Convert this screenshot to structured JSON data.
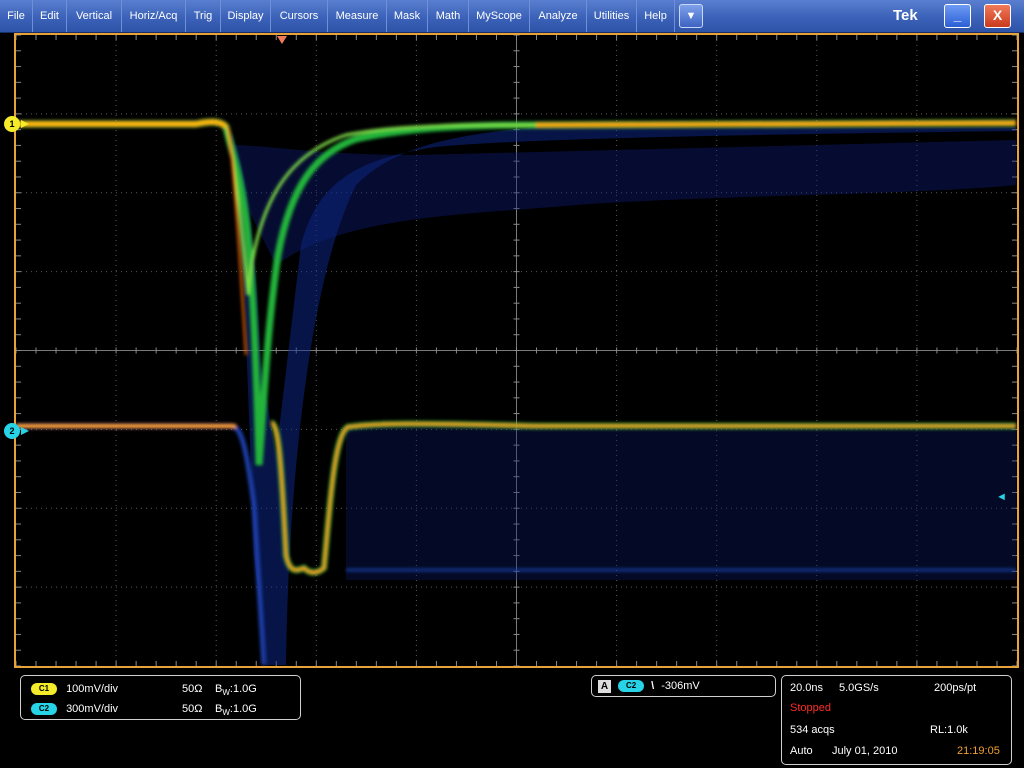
{
  "menu": {
    "items": [
      "File",
      "Edit",
      "Vertical",
      "Horiz/Acq",
      "Trig",
      "Display",
      "Cursors",
      "Measure",
      "Mask",
      "Math",
      "MyScope",
      "Analyze",
      "Utilities",
      "Help"
    ],
    "dropdown_glyph": "▼",
    "brand": "Tek",
    "minimize_glyph": "_",
    "close_glyph": "X"
  },
  "markers": {
    "ch1": "1",
    "ch2": "2"
  },
  "vertical": {
    "ch1": {
      "badge": "C1",
      "scale": "100mV/div",
      "impedance": "50Ω",
      "bw_prefix": "B",
      "bw_sub": "W",
      "bw_value": ":1.0G"
    },
    "ch2": {
      "badge": "C2",
      "scale": "300mV/div",
      "impedance": "50Ω",
      "bw_prefix": "B",
      "bw_sub": "W",
      "bw_value": ":1.0G"
    }
  },
  "trigger": {
    "mode_letter": "A",
    "source": "C2",
    "slope_glyph": "\\",
    "level": "-306mV"
  },
  "horizontal": {
    "time_per_div": "20.0ns",
    "sample_rate": "5.0GS/s",
    "resolution": "200ps/pt",
    "state": "Stopped",
    "acquisitions": "534 acqs",
    "record_length": "RL:1.0k",
    "trigger_mode": "Auto",
    "date": "July 01, 2010",
    "time": "21:19:05"
  },
  "colors": {
    "ch1": "#f4ec2a",
    "ch2": "#27d3e6",
    "frame": "#e8a23a",
    "stopped": "#ff2a2a",
    "time": "#f0a030"
  }
}
